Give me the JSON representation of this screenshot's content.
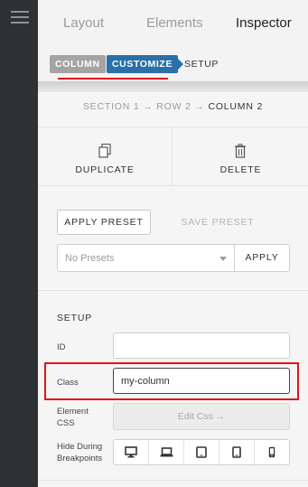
{
  "tabs": {
    "layout": "Layout",
    "elements": "Elements",
    "inspector": "Inspector"
  },
  "subnav": {
    "column": "COLUMN",
    "customize": "CUSTOMIZE",
    "setup": "SETUP"
  },
  "breadcrumb": {
    "section": "SECTION 1",
    "row": "ROW 2",
    "column": "COLUMN 2",
    "arrow": "→"
  },
  "actions": {
    "duplicate": "DUPLICATE",
    "delete": "DELETE"
  },
  "presets": {
    "apply_preset": "APPLY PRESET",
    "save_preset": "SAVE PRESET",
    "placeholder": "No Presets",
    "apply": "APPLY"
  },
  "setup": {
    "title": "SETUP",
    "id_label": "ID",
    "id_value": "",
    "class_label": "Class",
    "class_value": "my-column",
    "element_css_label_1": "Element",
    "element_css_label_2": "CSS",
    "edit_css": "Edit Css →",
    "hide_label_1": "Hide During",
    "hide_label_2": "Breakpoints"
  },
  "breakpoint_icons": [
    "desktop-icon",
    "laptop-icon",
    "tablet-landscape-icon",
    "tablet-portrait-icon",
    "phone-icon"
  ],
  "colors": {
    "accent": "#2a6fa8",
    "highlight": "#e0141a",
    "rail": "#2e3235"
  }
}
